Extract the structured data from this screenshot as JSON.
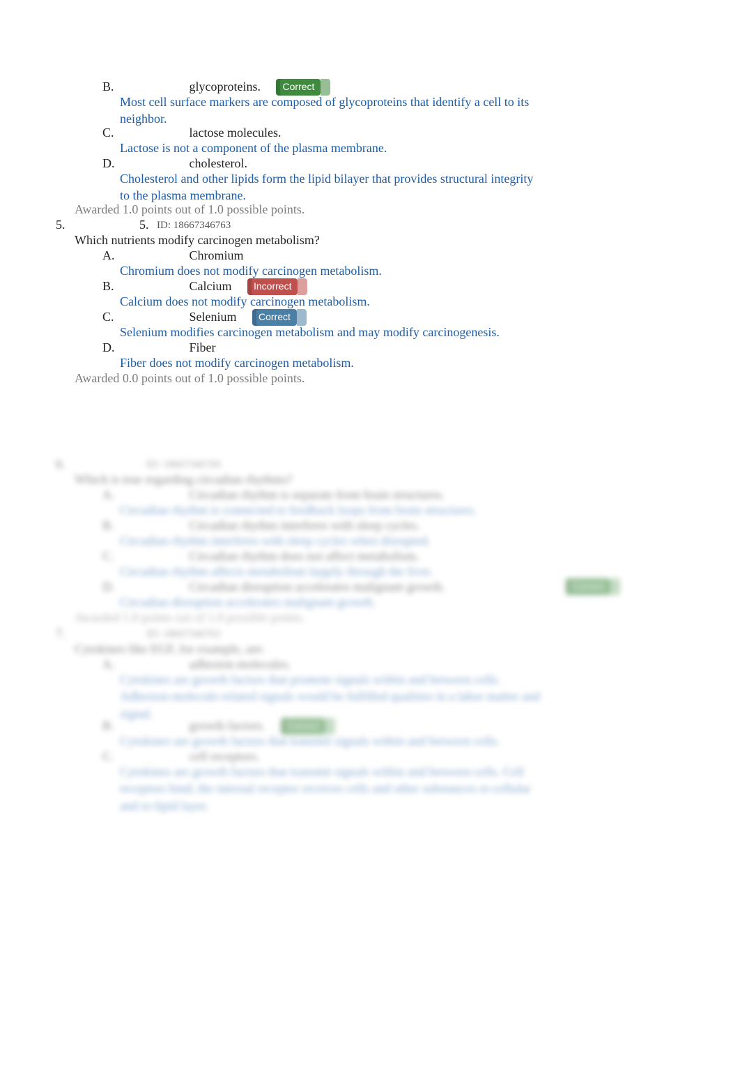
{
  "badges": {
    "correct": "Correct",
    "incorrect": "Incorrect"
  },
  "q4_tail": {
    "opts": [
      {
        "letter": "B.",
        "text": "glycoproteins.",
        "badge": "correct",
        "explain": "Most cell surface markers are composed of glycoproteins that identify a cell to its neighbor."
      },
      {
        "letter": "C.",
        "text": "lactose molecules.",
        "explain": "Lactose is not a component of the plasma membrane."
      },
      {
        "letter": "D.",
        "text": "cholesterol.",
        "explain": "Cholesterol and other lipids form the lipid bilayer that provides structural integrity to the plasma membrane."
      }
    ],
    "awarded": "Awarded 1.0 points out of 1.0 possible points."
  },
  "q5": {
    "outer_num": "5.",
    "inner_num": "5.",
    "id": "ID: 18667346763",
    "stem": "Which nutrients modify carcinogen metabolism?",
    "opts": [
      {
        "letter": "A.",
        "text": "Chromium",
        "explain": "Chromium does not modify carcinogen metabolism."
      },
      {
        "letter": "B.",
        "text": "Calcium",
        "badge": "incorrect",
        "explain": "Calcium does not modify carcinogen metabolism."
      },
      {
        "letter": "C.",
        "text": "Selenium",
        "badge": "correct-blue",
        "explain": "Selenium modifies carcinogen metabolism and may modify carcinogenesis."
      },
      {
        "letter": "D.",
        "text": "Fiber",
        "explain": "Fiber does not modify carcinogen metabolism."
      }
    ],
    "awarded": "Awarded 0.0 points out of 1.0 possible points."
  },
  "q6_blur": {
    "outer_num": "6.",
    "id": "ID: 18667346769",
    "stem": "Which is true regarding circadian rhythms?",
    "opts": [
      {
        "letter": "A.",
        "text": "Circadian rhythm is separate from brain structures.",
        "explain": "Circadian rhythm is connected to feedback loops from brain structures."
      },
      {
        "letter": "B.",
        "text": "Circadian rhythm interferes with sleep cycles.",
        "explain": "Circadian rhythm interferes with sleep cycles when disrupted."
      },
      {
        "letter": "C.",
        "text": "Circadian rhythm does not affect metabolism.",
        "explain": "Circadian rhythm affects metabolism largely through the liver."
      },
      {
        "letter": "D.",
        "text": "Circadian disruption accelerates malignant growth.",
        "badge": "correct",
        "badge_far": true,
        "explain": "Circadian disruption accelerates malignant growth."
      }
    ],
    "awarded": "Awarded 1.0 points out of 1.0 possible points."
  },
  "q7_blur": {
    "outer_num": "7.",
    "id": "ID: 18667346763",
    "stem": "Cytokines like EGF, for example, are:",
    "opts": [
      {
        "letter": "A.",
        "text": "adhesion molecules.",
        "explain": "Cytokines are growth factors that promote signals within and between cells. Adhesion-molecule-related signals would be fulfilled qualities in a labor matter and signal."
      },
      {
        "letter": "B.",
        "text": "growth factors.",
        "badge": "correct",
        "explain": "Cytokines are growth factors that transmit signals within and between cells."
      },
      {
        "letter": "C.",
        "text": "cell receptors.",
        "explain": "Cytokines are growth factors that transmit signals within and between cells. Cell receptors bind; the internal receptor receives cells and other substances re-cellular and re-lipid layer."
      }
    ]
  }
}
